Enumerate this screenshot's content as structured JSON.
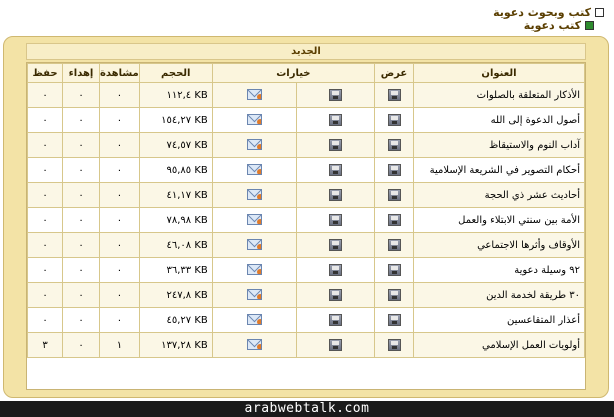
{
  "breadcrumbs": {
    "parent": "كتب وبحوث دعوية",
    "current": "كتب دعوية"
  },
  "panel_title": "الجديد",
  "table": {
    "headers": {
      "title": "العنوان",
      "view": "عرض",
      "options": "خيارات",
      "size": "الحجم",
      "views": "مشاهدة",
      "gifts": "إهداء",
      "saves": "حفظ"
    },
    "rows": [
      {
        "title": "الأذكار المتعلقة بالصلوات",
        "size": "KB ١١٢,٤",
        "views": "٠",
        "gifts": "٠",
        "saves": "٠"
      },
      {
        "title": "أصول الدعوة إلى الله",
        "size": "KB ١٥٤,٢٧",
        "views": "٠",
        "gifts": "٠",
        "saves": "٠"
      },
      {
        "title": "آداب النوم والاستيقاظ",
        "size": "KB ٧٤,٥٧",
        "views": "٠",
        "gifts": "٠",
        "saves": "٠"
      },
      {
        "title": "أحكام التصوير في الشريعة الإسلامية",
        "size": "KB ٩٥,٨٥",
        "views": "٠",
        "gifts": "٠",
        "saves": "٠"
      },
      {
        "title": "أحاديث عشر ذي الحجة",
        "size": "KB ٤١,١٧",
        "views": "٠",
        "gifts": "٠",
        "saves": "٠"
      },
      {
        "title": "الأمة بين سنتي الابتلاء والعمل",
        "size": "KB ٧٨,٩٨",
        "views": "٠",
        "gifts": "٠",
        "saves": "٠"
      },
      {
        "title": "الأوقاف وأثرها الاجتماعي",
        "size": "KB ٤٦,٠٨",
        "views": "٠",
        "gifts": "٠",
        "saves": "٠"
      },
      {
        "title": "٩٢ وسيلة دعوية",
        "size": "KB ٣٦,٣٣",
        "views": "٠",
        "gifts": "٠",
        "saves": "٠"
      },
      {
        "title": "٣٠ طريقة لخدمة الدين",
        "size": "KB ٢٤٧,٨",
        "views": "٠",
        "gifts": "٠",
        "saves": "٠"
      },
      {
        "title": "أعذار المتقاعسين",
        "size": "KB ٤٥,٢٧",
        "views": "٠",
        "gifts": "٠",
        "saves": "٠"
      },
      {
        "title": "أولويات العمل الإسلامي",
        "size": "KB ١٣٧,٢٨",
        "views": "١",
        "gifts": "٠",
        "saves": "٣"
      }
    ]
  },
  "footer": "arabwebtalk.com",
  "icons": {
    "view": "save-disk-icon",
    "option_save": "save-disk-icon",
    "option_send": "envelope-icon"
  },
  "colors": {
    "frame": "#f3e3a6",
    "footer_bg": "#1a1a1a",
    "text_brown": "#5a3e00"
  }
}
